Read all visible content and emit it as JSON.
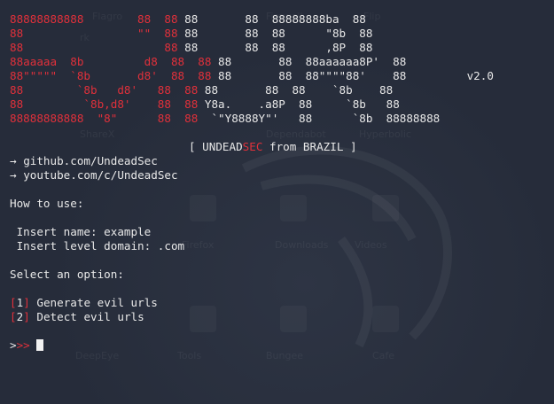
{
  "banner": {
    "rows": [
      {
        "red": "88888888888        88  88 ",
        "white": "88       88  88888888ba  88"
      },
      {
        "red": "88                 \"\"  88 ",
        "white": "88       88  88      \"8b  88"
      },
      {
        "red": "88                     88 ",
        "white": "88       88  88      ,8P  88"
      },
      {
        "red": "88aaaaa  8b         d8  88  88 ",
        "white": "88       88  88aaaaaa8P'  88"
      },
      {
        "red": "88\"\"\"\"\"  `8b       d8'  88  88 ",
        "white": "88       88  88\"\"\"\"88'    88         v2.0"
      },
      {
        "red": "88        `8b   d8'   88  88 ",
        "white": "88       88  88    `8b    88"
      },
      {
        "red": "88         `8b,d8'    88  88 ",
        "white": "Y8a.    .a8P  88     `8b   88"
      },
      {
        "red": "88888888888  \"8\"      88  88 ",
        "white": " `\"Y8888Y\"'   88      `8b  88888888"
      }
    ],
    "tagline_open": "[ UNDEAD",
    "tagline_red": "SEC",
    "tagline_close": " from BRAZIL ]"
  },
  "links": [
    {
      "arrow": "→",
      "text": "github.com/UndeadSec"
    },
    {
      "arrow": "→",
      "text": "youtube.com/c/UndeadSec"
    }
  ],
  "usage": {
    "heading": "How to use:",
    "lines": [
      " Insert name: example",
      " Insert level domain: .com"
    ]
  },
  "menu": {
    "heading": "Select an option:",
    "options": [
      {
        "num": "1",
        "label": "Generate evil urls"
      },
      {
        "num": "2",
        "label": "Detect evil urls"
      }
    ]
  },
  "prompt": {
    "first": ">",
    "second": ">>"
  },
  "desktop_ghost": {
    "labels": [
      "rk",
      "Flagro",
      "Shell Script",
      "Firewall",
      "Flip",
      "Flaticon",
      "Pilaf",
      "Dependabot",
      "Hyperbolic",
      "ShareX",
      "MBaka",
      "Firefox",
      "Downloads",
      "Videos",
      "Pictures",
      "Sunscreen",
      "Apps",
      "DeepEye",
      "Tools",
      "Bungee",
      "Cafe"
    ]
  }
}
